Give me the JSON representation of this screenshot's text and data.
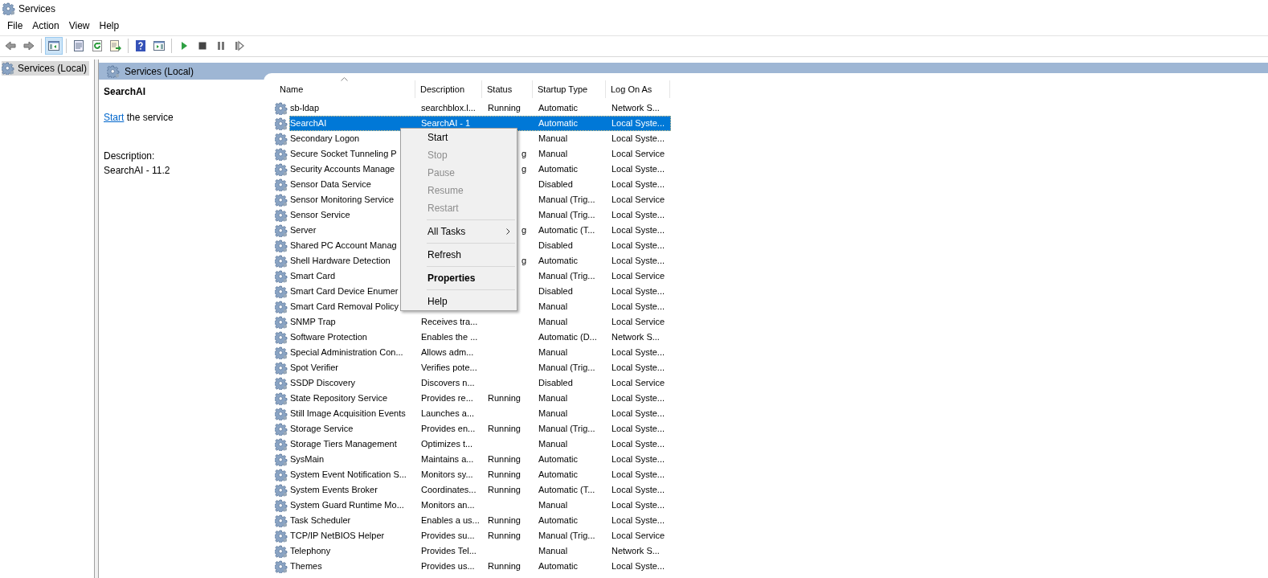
{
  "window": {
    "title": "Services"
  },
  "menu_bar": [
    "File",
    "Action",
    "View",
    "Help"
  ],
  "toolbar": [
    {
      "kind": "back",
      "pressed": false
    },
    {
      "kind": "forward",
      "pressed": false
    },
    {
      "kind": "separator"
    },
    {
      "kind": "console-tree",
      "pressed": true
    },
    {
      "kind": "separator"
    },
    {
      "kind": "properties",
      "pressed": false
    },
    {
      "kind": "refresh",
      "pressed": false
    },
    {
      "kind": "export",
      "pressed": false
    },
    {
      "kind": "separator"
    },
    {
      "kind": "help",
      "pressed": false
    },
    {
      "kind": "action-pane",
      "pressed": false
    },
    {
      "kind": "separator"
    },
    {
      "kind": "start",
      "pressed": false
    },
    {
      "kind": "stop",
      "pressed": false
    },
    {
      "kind": "pause",
      "pressed": false
    },
    {
      "kind": "resume",
      "pressed": false
    }
  ],
  "tree": [
    {
      "label": "Services (Local)",
      "selected": true
    }
  ],
  "pane": {
    "title": "Services (Local)",
    "detail": {
      "name": "SearchAI",
      "action_link": "Start",
      "action_text": "the service",
      "description_label": "Description:",
      "description": "SearchAI - 11.2"
    }
  },
  "table": {
    "columns": [
      {
        "label": "Name",
        "sorted": true
      },
      {
        "label": "Description",
        "sorted": false
      },
      {
        "label": "Status",
        "sorted": false
      },
      {
        "label": "Startup Type",
        "sorted": false
      },
      {
        "label": "Log On As",
        "sorted": false
      }
    ],
    "rows": [
      {
        "name": "sb-ldap",
        "description": "searchblox.l...",
        "status": "Running",
        "startup_type": "Automatic",
        "log_on_as": "Network S...",
        "selected": false
      },
      {
        "name": "SearchAI",
        "description": "SearchAI - 1",
        "startup_type": "Automatic",
        "log_on_as": "Local Syste...",
        "selected": true
      },
      {
        "name": "Secondary Logon",
        "startup_type": "Manual",
        "log_on_as": "Local Syste...",
        "selected": false
      },
      {
        "name": "Secure Socket Tunneling P",
        "status": "g",
        "status_cut": true,
        "startup_type": "Manual",
        "log_on_as": "Local Service",
        "selected": false
      },
      {
        "name": "Security Accounts Manage",
        "status": "g",
        "status_cut": true,
        "startup_type": "Automatic",
        "log_on_as": "Local Syste...",
        "selected": false
      },
      {
        "name": "Sensor Data Service",
        "startup_type": "Disabled",
        "log_on_as": "Local Syste...",
        "selected": false
      },
      {
        "name": "Sensor Monitoring Service",
        "startup_type": "Manual (Trig...",
        "log_on_as": "Local Service",
        "selected": false
      },
      {
        "name": "Sensor Service",
        "startup_type": "Manual (Trig...",
        "log_on_as": "Local Syste...",
        "selected": false
      },
      {
        "name": "Server",
        "status": "g",
        "status_cut": true,
        "startup_type": "Automatic (T...",
        "log_on_as": "Local Syste...",
        "selected": false
      },
      {
        "name": "Shared PC Account Manag",
        "startup_type": "Disabled",
        "log_on_as": "Local Syste...",
        "selected": false
      },
      {
        "name": "Shell Hardware Detection",
        "status": "g",
        "status_cut": true,
        "startup_type": "Automatic",
        "log_on_as": "Local Syste...",
        "selected": false
      },
      {
        "name": "Smart Card",
        "startup_type": "Manual (Trig...",
        "log_on_as": "Local Service",
        "selected": false
      },
      {
        "name": "Smart Card Device Enumer",
        "startup_type": "Disabled",
        "log_on_as": "Local Syste...",
        "selected": false
      },
      {
        "name": "Smart Card Removal Policy",
        "startup_type": "Manual",
        "log_on_as": "Local Syste...",
        "selected": false
      },
      {
        "name": "SNMP Trap",
        "description": "Receives tra...",
        "startup_type": "Manual",
        "log_on_as": "Local Service",
        "selected": false
      },
      {
        "name": "Software Protection",
        "description": "Enables the ...",
        "startup_type": "Automatic (D...",
        "log_on_as": "Network S...",
        "selected": false
      },
      {
        "name": "Special Administration Con...",
        "description": "Allows adm...",
        "startup_type": "Manual",
        "log_on_as": "Local Syste...",
        "selected": false
      },
      {
        "name": "Spot Verifier",
        "description": "Verifies pote...",
        "startup_type": "Manual (Trig...",
        "log_on_as": "Local Syste...",
        "selected": false
      },
      {
        "name": "SSDP Discovery",
        "description": "Discovers n...",
        "startup_type": "Disabled",
        "log_on_as": "Local Service",
        "selected": false
      },
      {
        "name": "State Repository Service",
        "description": "Provides re...",
        "status": "Running",
        "startup_type": "Manual",
        "log_on_as": "Local Syste...",
        "selected": false
      },
      {
        "name": "Still Image Acquisition Events",
        "description": "Launches a...",
        "startup_type": "Manual",
        "log_on_as": "Local Syste...",
        "selected": false
      },
      {
        "name": "Storage Service",
        "description": "Provides en...",
        "status": "Running",
        "startup_type": "Manual (Trig...",
        "log_on_as": "Local Syste...",
        "selected": false
      },
      {
        "name": "Storage Tiers Management",
        "description": "Optimizes t...",
        "startup_type": "Manual",
        "log_on_as": "Local Syste...",
        "selected": false
      },
      {
        "name": "SysMain",
        "description": "Maintains a...",
        "status": "Running",
        "startup_type": "Automatic",
        "log_on_as": "Local Syste...",
        "selected": false
      },
      {
        "name": "System Event Notification S...",
        "description": "Monitors sy...",
        "status": "Running",
        "startup_type": "Automatic",
        "log_on_as": "Local Syste...",
        "selected": false
      },
      {
        "name": "System Events Broker",
        "description": "Coordinates...",
        "status": "Running",
        "startup_type": "Automatic (T...",
        "log_on_as": "Local Syste...",
        "selected": false
      },
      {
        "name": "System Guard Runtime Mo...",
        "description": "Monitors an...",
        "startup_type": "Manual",
        "log_on_as": "Local Syste...",
        "selected": false
      },
      {
        "name": "Task Scheduler",
        "description": "Enables a us...",
        "status": "Running",
        "startup_type": "Automatic",
        "log_on_as": "Local Syste...",
        "selected": false
      },
      {
        "name": "TCP/IP NetBIOS Helper",
        "description": "Provides su...",
        "status": "Running",
        "startup_type": "Manual (Trig...",
        "log_on_as": "Local Service",
        "selected": false
      },
      {
        "name": "Telephony",
        "description": "Provides Tel...",
        "startup_type": "Manual",
        "log_on_as": "Network S...",
        "selected": false
      },
      {
        "name": "Themes",
        "description": "Provides us...",
        "status": "Running",
        "startup_type": "Automatic",
        "log_on_as": "Local Syste...",
        "selected": false
      }
    ]
  },
  "context_menu": {
    "items": [
      {
        "kind": "item",
        "label": "Start",
        "disabled": false,
        "default": false
      },
      {
        "kind": "item",
        "label": "Stop",
        "disabled": true,
        "default": false
      },
      {
        "kind": "item",
        "label": "Pause",
        "disabled": true,
        "default": false
      },
      {
        "kind": "item",
        "label": "Resume",
        "disabled": true,
        "default": false
      },
      {
        "kind": "item",
        "label": "Restart",
        "disabled": true,
        "default": false
      },
      {
        "kind": "separator"
      },
      {
        "kind": "submenu",
        "label": "All Tasks",
        "disabled": false,
        "default": false
      },
      {
        "kind": "separator"
      },
      {
        "kind": "item",
        "label": "Refresh",
        "disabled": false,
        "default": false
      },
      {
        "kind": "separator"
      },
      {
        "kind": "item",
        "label": "Properties",
        "disabled": false,
        "default": true
      },
      {
        "kind": "separator"
      },
      {
        "kind": "item",
        "label": "Help",
        "disabled": false,
        "default": false
      }
    ]
  }
}
